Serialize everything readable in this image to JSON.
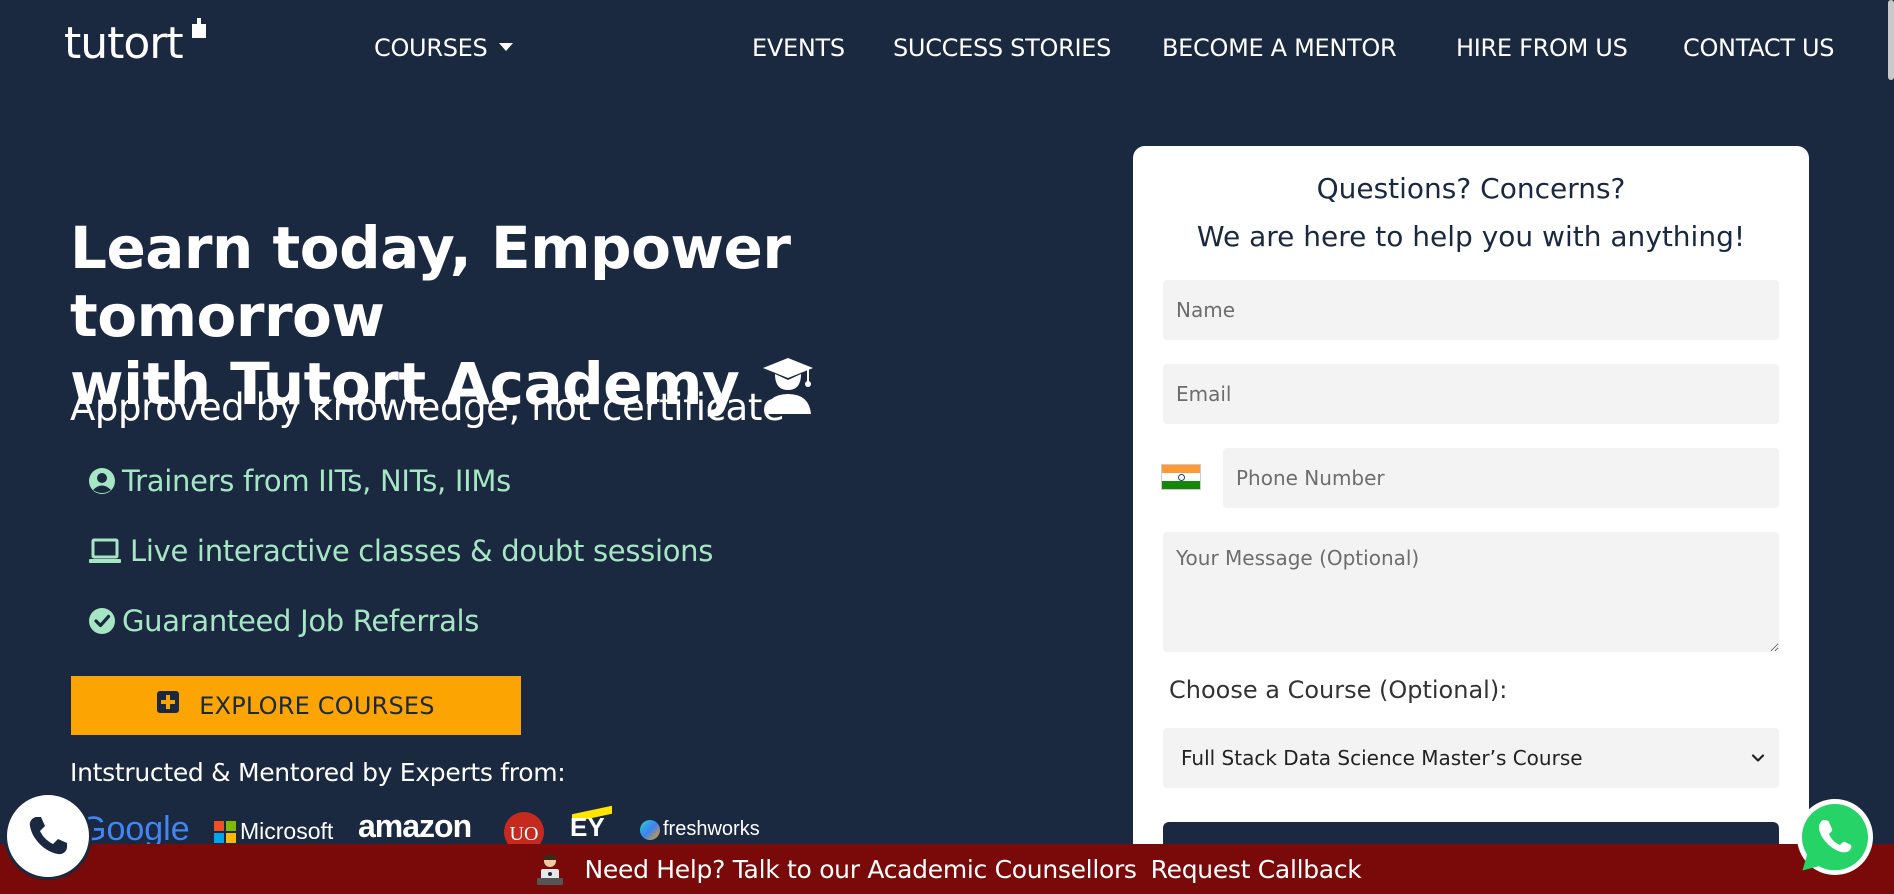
{
  "nav": {
    "logo": "tutort",
    "items": [
      {
        "label": "COURSES"
      },
      {
        "label": "EVENTS"
      },
      {
        "label": "SUCCESS STORIES"
      },
      {
        "label": "BECOME A MENTOR"
      },
      {
        "label": "HIRE FROM US"
      },
      {
        "label": "CONTACT US"
      }
    ]
  },
  "hero": {
    "title_line1": "Learn today, Empower tomorrow",
    "title_line2": "with Tutort Academy",
    "subtitle": "Approved by knowledge, not certificate",
    "features": [
      {
        "icon": "user-circle-icon",
        "text": "Trainers from IITs, NITs, IIMs"
      },
      {
        "icon": "laptop-icon",
        "text": "Live interactive classes & doubt sessions"
      },
      {
        "icon": "check-circle-icon",
        "text": "Guaranteed Job Referrals"
      }
    ],
    "explore_button": "EXPLORE COURSES",
    "experts_label": "Intstructed & Mentored by Experts from:",
    "logos": {
      "google": "Google",
      "microsoft": "Microsoft",
      "amazon": "amazon",
      "uo": "UO",
      "ey": "EY",
      "freshworks": "freshworks"
    }
  },
  "form": {
    "heading1": "Questions? Concerns?",
    "heading2": "We are here to help you with anything!",
    "name_placeholder": "Name",
    "email_placeholder": "Email",
    "phone_placeholder": "Phone Number",
    "message_placeholder": "Your Message (Optional)",
    "course_label": "Choose a Course (Optional):",
    "course_selected": "Full Stack Data Science Master’s Course"
  },
  "help_bar": {
    "text": "Need Help? Talk to our Academic Counsellors",
    "link": "Request Callback"
  },
  "colors": {
    "background": "#1a2840",
    "accent": "#fca502",
    "feature_text": "#a6e6c4",
    "help_bar": "#7a0a0a",
    "whatsapp": "#25d366"
  }
}
